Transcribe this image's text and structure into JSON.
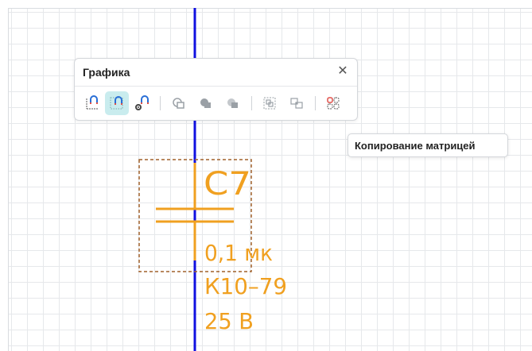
{
  "panel": {
    "title": "Графика",
    "close_icon": "close-icon",
    "tools": [
      {
        "name": "magnet-grid-snap-icon",
        "active": false
      },
      {
        "name": "magnet-grid-icon",
        "active": true
      },
      {
        "name": "magnet-gear-icon",
        "active": false
      },
      {
        "name": "shape-union-icon",
        "active": false
      },
      {
        "name": "shape-subtract-icon",
        "active": false
      },
      {
        "name": "shape-intersect-icon",
        "active": false
      },
      {
        "name": "group-select-icon",
        "active": false
      },
      {
        "name": "ungroup-select-icon",
        "active": false
      },
      {
        "name": "matrix-copy-icon",
        "active": false
      }
    ]
  },
  "tooltip": {
    "text": "Копирование матрицей"
  },
  "schematic": {
    "designator": "C7",
    "value": "0,1 мк",
    "type": "К10–79",
    "voltage": "25 В",
    "wire_color": "#1010e0",
    "component_color": "#f0a020",
    "selection_color": "#a0602a"
  },
  "colors": {
    "accent": "#c9ecee",
    "grid": "#e6e8eb"
  }
}
